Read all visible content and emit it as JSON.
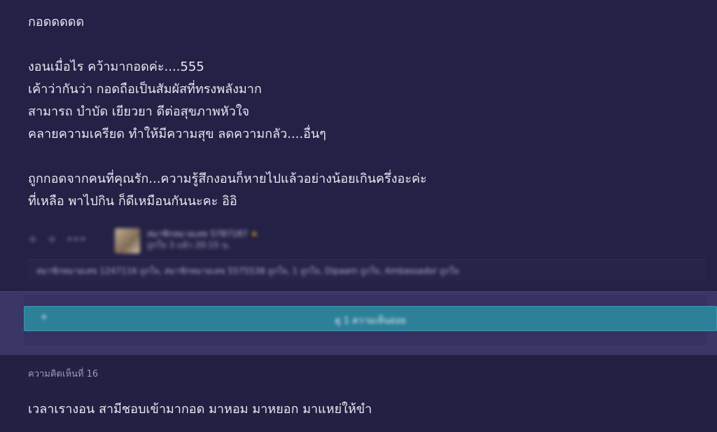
{
  "post": {
    "lines": [
      "กอดดดดด",
      "",
      "งอนเมื่อไร คว้ามากอดค่ะ....555",
      "เค้าว่ากันว่า กอดถือเป็นสัมผัสที่ทรงพลังมาก",
      "สามารถ บำบัด เยียวยา ดีต่อสุขภาพหัวใจ",
      "คลายความเครียด ทำให้มีความสุข ลดความกลัว....อื่นๆ",
      "",
      "ถูกกอดจากคนที่คุณรัก...ความรู้สึกงอนก็หายไปแล้วอย่างน้อยเกินครึ่งอะค่ะ",
      "ที่เหลือ พาไปกิน ก็ดีเหมือนกันนะคะ อิอิ"
    ]
  },
  "meta": {
    "icons": [
      "plus-icon",
      "minus-icon",
      "ellipsis-icon"
    ],
    "user_name": "สมาชิกหมายเลข 5787187",
    "user_sub": "ถูกใจ 3 แล้ว 20:15 น.",
    "medal": "★",
    "tagline": "สมาชิกหมายเลข 1247116 ถูกใจ, สมาชิกหมายเลข 5575538 ถูกใจ, 1 ถูกใจ, Dipaam ถูกใจ, Ambassador ถูกใจ"
  },
  "reply": {
    "plus": "+",
    "label": "ดู 1 ความเห็นย่อย"
  },
  "comment": {
    "number": "ความคิดเห็นที่ 16",
    "text": "เวลาเรางอน สามีชอบเข้ามากอด มาหอม มาหยอก มาแหย่ให้ขำ"
  },
  "colors": {
    "background": "#222043",
    "band": "#3a3665",
    "reply_bar": "#2e7f98",
    "text": "#e9e8f2",
    "muted": "#9e9cb6"
  }
}
